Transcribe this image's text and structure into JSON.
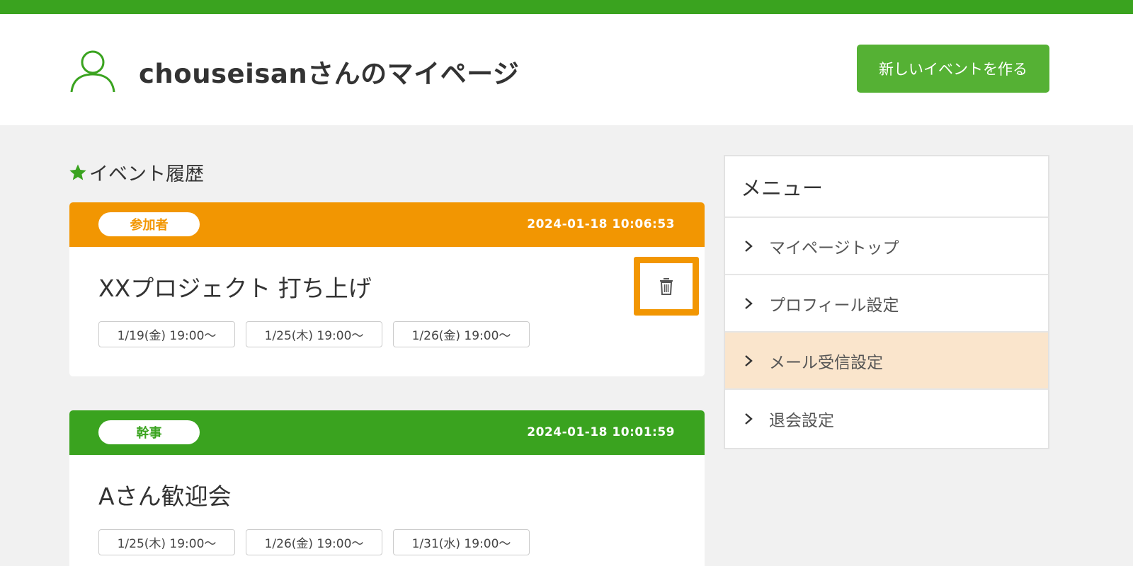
{
  "header": {
    "title": "chouseisanさんのマイページ",
    "new_event_button": "新しいイベントを作る"
  },
  "history": {
    "title": "イベント履歴",
    "events": [
      {
        "role": "参加者",
        "datetime": "2024-01-18 10:06:53",
        "title": "XXプロジェクト 打ち上げ",
        "dates": [
          "1/19(金) 19:00〜",
          "1/25(木) 19:00〜",
          "1/26(金) 19:00〜"
        ]
      },
      {
        "role": "幹事",
        "datetime": "2024-01-18 10:01:59",
        "title": "Aさん歓迎会",
        "dates": [
          "1/25(木) 19:00〜",
          "1/26(金) 19:00〜",
          "1/31(水) 19:00〜"
        ]
      }
    ]
  },
  "menu": {
    "title": "メニュー",
    "items": [
      "マイページトップ",
      "プロフィール設定",
      "メール受信設定",
      "退会設定"
    ]
  },
  "colors": {
    "brand_green": "#3aa31f",
    "button_green": "#55b134",
    "orange": "#f29602",
    "active_menu_bg": "#fae5cc"
  },
  "icons": [
    "user-icon",
    "star-icon",
    "trash-icon",
    "chevron-right-icon"
  ]
}
